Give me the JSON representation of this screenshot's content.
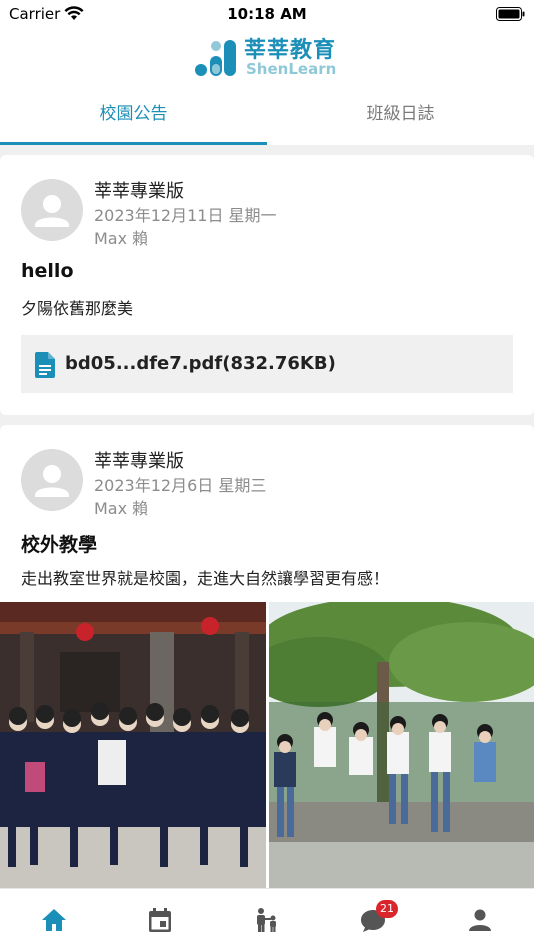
{
  "status_bar": {
    "carrier": "Carrier",
    "time": "10:18 AM"
  },
  "header": {
    "logo_cn": "莘莘教育",
    "logo_en": "ShenLearn"
  },
  "tabs": [
    {
      "label": "校園公告",
      "active": true
    },
    {
      "label": "班級日誌",
      "active": false
    }
  ],
  "posts": [
    {
      "author": "莘莘專業版",
      "date": "2023年12月11日 星期一",
      "poster": "Max 賴",
      "title": "hello",
      "content": "夕陽依舊那麼美",
      "attachment": "bd05...dfe7.pdf(832.76KB)"
    },
    {
      "author": "莘莘專業版",
      "date": "2023年12月6日 星期三",
      "poster": "Max 賴",
      "title": "校外教學",
      "content": "走出教室世界就是校園，走進大自然讓學習更有感！"
    }
  ],
  "tabbar": {
    "items": [
      "home-icon",
      "calendar-icon",
      "family-icon",
      "chat-icon",
      "person-icon"
    ],
    "chat_badge": "21"
  },
  "colors": {
    "accent": "#1b8fb8",
    "badge": "#d9262c"
  }
}
